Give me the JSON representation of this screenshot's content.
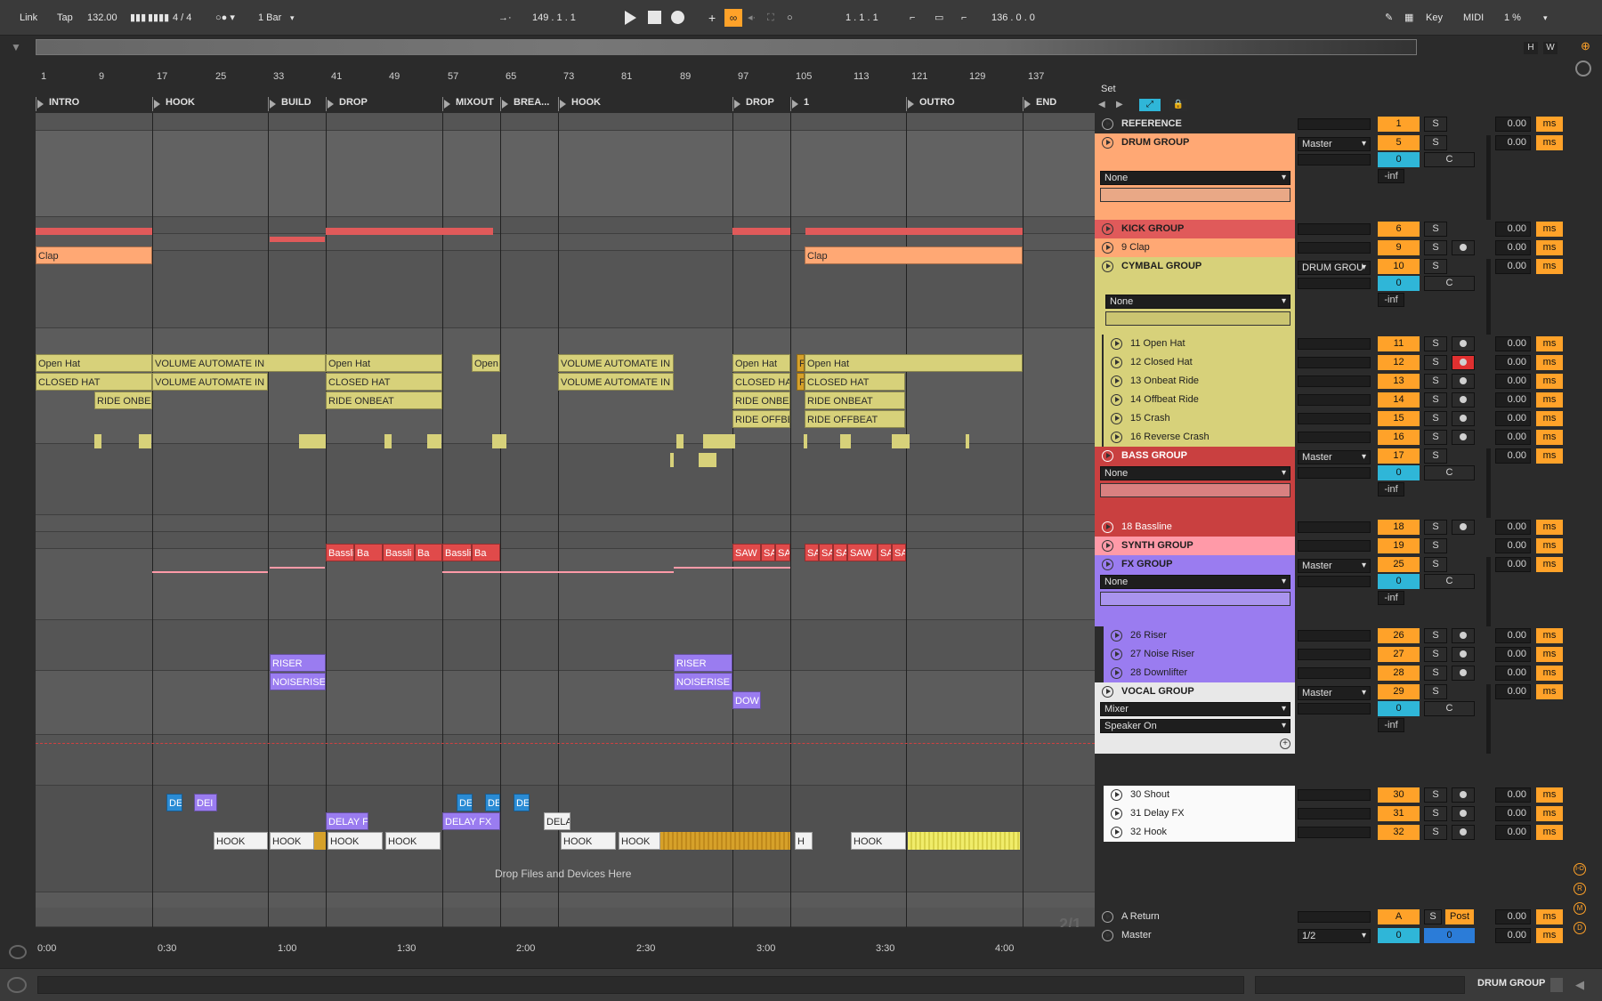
{
  "transport": {
    "link": "Link",
    "tap": "Tap",
    "tempo": "132.00",
    "time_sig": "4 / 4",
    "quantize": "1 Bar",
    "arrangement_pos": "149 .  1 .  1",
    "loop_start": "1 .  1 .  1",
    "loop_length": "136 .  0 .  0",
    "key": "Key",
    "midi": "MIDI",
    "cpu": "1 %"
  },
  "overview": {
    "h": "H",
    "w": "W"
  },
  "ruler": [
    "1",
    "9",
    "17",
    "25",
    "33",
    "41",
    "49",
    "57",
    "65",
    "73",
    "81",
    "89",
    "97",
    "105",
    "113",
    "121",
    "129",
    "137"
  ],
  "set_label": "Set",
  "locators": [
    "INTRO",
    "HOOK",
    "BUILD",
    "DROP",
    "MIXOUT",
    "BREA...",
    "HOOK",
    "DROP",
    "1",
    "OUTRO",
    "END"
  ],
  "clips": {
    "clap1": "Clap",
    "clap2": "Clap",
    "openhat1": "Open Hat",
    "volauto1": "VOLUME AUTOMATE IN",
    "openhat2": "Open Hat",
    "openhat3": "Open",
    "volauto2": "VOLUME AUTOMATE IN",
    "openhat4": "Open Hat",
    "openhat5": "F",
    "openhat6": "Open Hat",
    "closedhat1": "CLOSED HAT",
    "volauto3": "VOLUME AUTOMATE IN",
    "closedhat2": "CLOSED HAT",
    "volauto4": "VOLUME AUTOMATE IN",
    "closedhat3": "CLOSED HA",
    "closedhat4": "F",
    "closedhat5": "CLOSED HAT",
    "ride1": "RIDE ONBEA",
    "ride2": "RIDE ONBEAT",
    "ride3": "RIDE ONBEA",
    "ride4": "RIDE ONBEAT",
    "rideoff1": "RIDE OFFBE",
    "rideoff2": "RIDE OFFBEAT",
    "bass1": "Bassli",
    "bass2": "Ba",
    "bass3": "Bassli",
    "bass4": "Ba",
    "bass5": "Bassli",
    "bass6": "Ba",
    "saw1": "SAW",
    "saw2": "SA",
    "saw3": "SA",
    "saw4": "SA",
    "saw5": "SA",
    "saw6": "SA",
    "saw7": "SAW",
    "saw8": "SA",
    "saw9": "SA",
    "riser1": "RISER",
    "riser2": "RISER",
    "noise1": "NOISERISE",
    "noise2": "NOISERISE",
    "down": "DOW",
    "shout1": "DE",
    "shout2": "DEI",
    "shout3": "DE",
    "shout4": "DE",
    "shout5": "DE",
    "delay1": "DELAY F.",
    "delay2": "DELAY FX",
    "delay3": "DELA",
    "hook1": "HOOK",
    "hook2": "HOOK",
    "hook3": "HOOK",
    "hook4": "HOOK",
    "hook5": "HOOK",
    "hook6": "HOOK",
    "hook7": "HOOK",
    "hook8": "H"
  },
  "drop_hint": "Drop Files and Devices Here",
  "page_indicator": "2/1",
  "timeline": [
    "0:00",
    "0:30",
    "1:00",
    "1:30",
    "2:00",
    "2:30",
    "3:00",
    "3:30",
    "4:00"
  ],
  "tracks": {
    "reference": {
      "name": "REFERENCE",
      "num": "1",
      "delay": "0.00"
    },
    "drum_group": {
      "name": "DRUM GROUP",
      "out": "Master",
      "num": "5",
      "pan": "0",
      "c": "C",
      "vol": "-inf",
      "input": "None",
      "delay": "0.00"
    },
    "kick_group": {
      "name": "KICK GROUP",
      "num": "6",
      "delay": "0.00"
    },
    "clap": {
      "name": "9 Clap",
      "num": "9",
      "delay": "0.00"
    },
    "cymbal_group": {
      "name": "CYMBAL GROUP",
      "out": "DRUM GROU",
      "num": "10",
      "pan": "0",
      "c": "C",
      "vol": "-inf",
      "input": "None",
      "delay": "0.00"
    },
    "open_hat": {
      "name": "11 Open Hat",
      "num": "11",
      "delay": "0.00"
    },
    "closed_hat": {
      "name": "12 Closed Hat",
      "num": "12",
      "delay": "0.00"
    },
    "onbeat_ride": {
      "name": "13 Onbeat Ride",
      "num": "13",
      "delay": "0.00"
    },
    "offbeat_ride": {
      "name": "14 Offbeat Ride",
      "num": "14",
      "delay": "0.00"
    },
    "crash": {
      "name": "15 Crash",
      "num": "15",
      "delay": "0.00"
    },
    "reverse_crash": {
      "name": "16 Reverse Crash",
      "num": "16",
      "delay": "0.00"
    },
    "bass_group": {
      "name": "BASS GROUP",
      "out": "Master",
      "num": "17",
      "pan": "0",
      "c": "C",
      "vol": "-inf",
      "input": "None",
      "delay": "0.00"
    },
    "bassline": {
      "name": "18 Bassline",
      "num": "18",
      "delay": "0.00"
    },
    "synth_group": {
      "name": "SYNTH GROUP",
      "num": "19",
      "delay": "0.00"
    },
    "fx_group": {
      "name": "FX GROUP",
      "out": "Master",
      "num": "25",
      "pan": "0",
      "c": "C",
      "vol": "-inf",
      "input": "None",
      "delay": "0.00"
    },
    "riser": {
      "name": "26 Riser",
      "num": "26",
      "delay": "0.00"
    },
    "noise_riser": {
      "name": "27 Noise Riser",
      "num": "27",
      "delay": "0.00"
    },
    "downlifter": {
      "name": "28 Downlifter",
      "num": "28",
      "delay": "0.00"
    },
    "vocal_group": {
      "name": "VOCAL GROUP",
      "out": "Master",
      "num": "29",
      "pan": "0",
      "c": "C",
      "vol": "-inf",
      "input1": "Mixer",
      "input2": "Speaker On",
      "delay": "0.00"
    },
    "shout": {
      "name": "30 Shout",
      "num": "30",
      "delay": "0.00"
    },
    "delay_fx": {
      "name": "31 Delay FX",
      "num": "31",
      "delay": "0.00"
    },
    "hook": {
      "name": "32 Hook",
      "num": "32",
      "delay": "0.00"
    },
    "a_return": {
      "name": "A Return",
      "num": "A",
      "post": "Post",
      "delay": "0.00"
    },
    "master": {
      "name": "Master",
      "num": "0",
      "pan": "0",
      "out": "1/2",
      "delay": "0.00"
    }
  },
  "s_label": "S",
  "ms_label": "ms",
  "right_badges": [
    "I-O",
    "R",
    "M",
    "D"
  ],
  "status": {
    "selected_track": "DRUM GROUP"
  },
  "colors": {
    "drum": "#ffa874",
    "kick": "#e05a5a",
    "cymbal": "#d7d17a",
    "bass": "#c94040",
    "synth": "#ff9aa8",
    "fx": "#9a7cf0",
    "vocal": "#f2f2f2",
    "accent": "#ffa229"
  }
}
